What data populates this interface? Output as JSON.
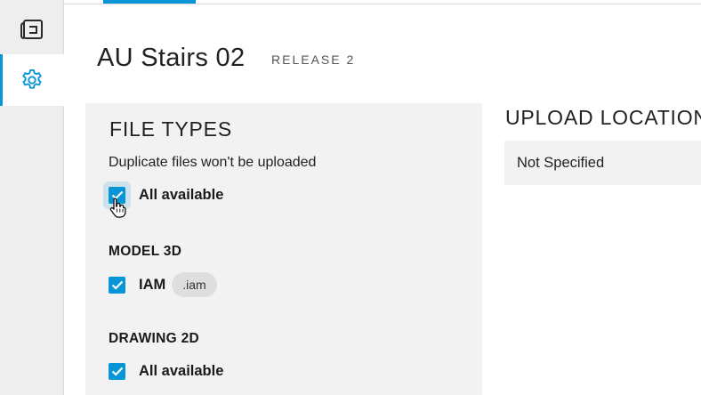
{
  "sidebar": {
    "items": [
      {
        "icon": "drawing-sheet-icon",
        "active": false
      },
      {
        "icon": "gear-icon",
        "active": true
      }
    ]
  },
  "header": {
    "title": "AU Stairs 02",
    "release": "RELEASE 2"
  },
  "file_types": {
    "title": "FILE TYPES",
    "note": "Duplicate files won't be uploaded",
    "all_available": {
      "label": "All available",
      "checked": true
    },
    "sections": [
      {
        "heading": "MODEL 3D",
        "items": [
          {
            "label": "IAM",
            "extension": ".iam",
            "checked": true
          }
        ]
      },
      {
        "heading": "DRAWING 2D",
        "items": [
          {
            "label": "All available",
            "checked": true
          }
        ]
      }
    ]
  },
  "upload_location": {
    "title": "UPLOAD LOCATION",
    "value": "Not Specified"
  },
  "colors": {
    "accent": "#0696d7",
    "panel_bg": "#f2f2f2",
    "sidebar_bg": "#eeeeee"
  }
}
